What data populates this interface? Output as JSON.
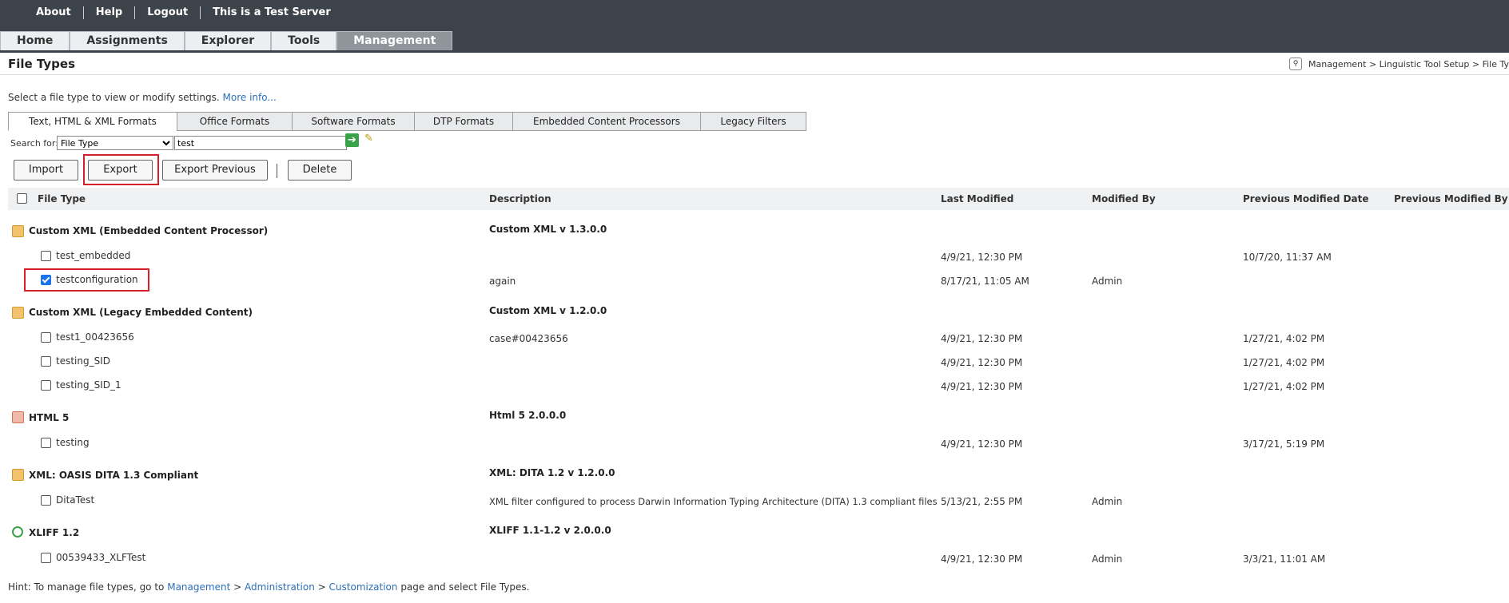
{
  "topbar": {
    "links": [
      "About",
      "Help",
      "Logout"
    ],
    "server_text": "This is a Test Server"
  },
  "nav": {
    "tabs": [
      "Home",
      "Assignments",
      "Explorer",
      "Tools",
      "Management"
    ],
    "active": "Management"
  },
  "page": {
    "title": "File Types",
    "breadcrumb": "Management > Linguistic Tool Setup > File Ty",
    "intro_text": "Select a file type to view or modify settings.",
    "more_info": "More info..."
  },
  "format_tabs": [
    "Text, HTML & XML Formats",
    "Office Formats",
    "Software Formats",
    "DTP Formats",
    "Embedded Content Processors",
    "Legacy Filters"
  ],
  "search": {
    "label": "Search for:",
    "field": "File Type",
    "value": "test"
  },
  "buttons": {
    "import": "Import",
    "export": "Export",
    "export_previous": "Export Previous",
    "delete": "Delete"
  },
  "table": {
    "headers": [
      "File Type",
      "Description",
      "Last Modified",
      "Modified By",
      "Previous Modified Date",
      "Previous Modified By"
    ],
    "groups": [
      {
        "name": "Custom XML (Embedded Content Processor)",
        "version": "Custom XML v 1.3.0.0",
        "icon": "xml-file-icon",
        "rows": [
          {
            "name": "test_embedded",
            "description": "",
            "last_modified": "4/9/21, 12:30 PM",
            "modified_by": "",
            "prev_date": "10/7/20, 11:37 AM",
            "prev_by": "",
            "checked": false
          },
          {
            "name": "testconfiguration",
            "description": "again",
            "last_modified": "8/17/21, 11:05 AM",
            "modified_by": "Admin",
            "prev_date": "",
            "prev_by": "",
            "checked": true
          }
        ]
      },
      {
        "name": "Custom XML (Legacy Embedded Content)",
        "version": "Custom XML v 1.2.0.0",
        "icon": "xml-file-icon",
        "rows": [
          {
            "name": "test1_00423656",
            "description": "case#00423656",
            "last_modified": "4/9/21, 12:30 PM",
            "modified_by": "",
            "prev_date": "1/27/21, 4:02 PM",
            "prev_by": "",
            "checked": false
          },
          {
            "name": "testing_SID",
            "description": "",
            "last_modified": "4/9/21, 12:30 PM",
            "modified_by": "",
            "prev_date": "1/27/21, 4:02 PM",
            "prev_by": "",
            "checked": false
          },
          {
            "name": "testing_SID_1",
            "description": "",
            "last_modified": "4/9/21, 12:30 PM",
            "modified_by": "",
            "prev_date": "1/27/21, 4:02 PM",
            "prev_by": "",
            "checked": false
          }
        ]
      },
      {
        "name": "HTML 5",
        "version": "Html 5 2.0.0.0",
        "icon": "html-file-icon",
        "rows": [
          {
            "name": "testing",
            "description": "",
            "last_modified": "4/9/21, 12:30 PM",
            "modified_by": "",
            "prev_date": "3/17/21, 5:19 PM",
            "prev_by": "",
            "checked": false
          }
        ]
      },
      {
        "name": "XML: OASIS DITA 1.3 Compliant",
        "version": "XML: DITA 1.2 v 1.2.0.0",
        "icon": "xml-file-icon",
        "rows": [
          {
            "name": "DitaTest",
            "description": "XML filter configured to process Darwin Information Typing Architecture (DITA) 1.3 compliant files",
            "last_modified": "5/13/21, 2:55 PM",
            "modified_by": "Admin",
            "prev_date": "",
            "prev_by": "",
            "checked": false
          }
        ]
      },
      {
        "name": "XLIFF 1.2",
        "version": "XLIFF 1.1-1.2 v 2.0.0.0",
        "icon": "xliff-file-icon",
        "rows": [
          {
            "name": "00539433_XLFTest",
            "description": "",
            "last_modified": "4/9/21, 12:30 PM",
            "modified_by": "Admin",
            "prev_date": "3/3/21, 11:01 AM",
            "prev_by": "",
            "checked": false
          }
        ]
      }
    ]
  },
  "hint": {
    "prefix": "Hint: To manage file types, go to",
    "link1": "Management",
    "sep": ">",
    "link2": "Administration",
    "link3": "Customization",
    "suffix": "page and select File Types."
  },
  "colors": {
    "topbar": "#3d434a",
    "active_tab": "#8f959b",
    "highlight_box": "#d5202a",
    "link": "#2e6fb8"
  }
}
